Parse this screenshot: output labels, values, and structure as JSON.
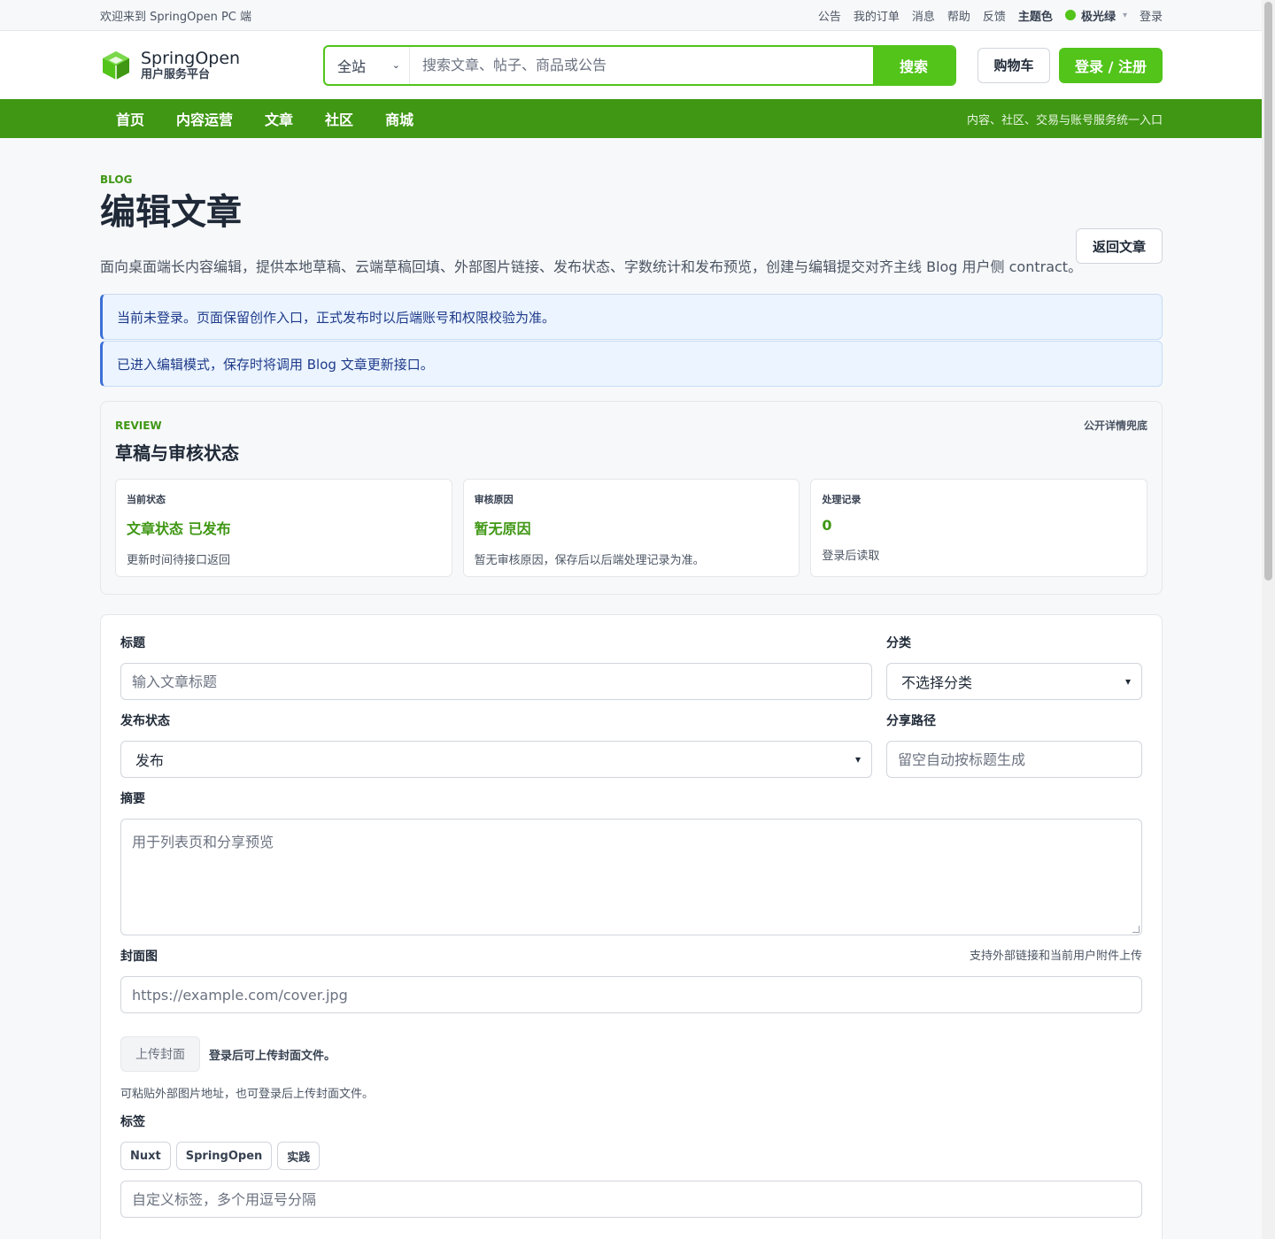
{
  "topbar": {
    "welcome": "欢迎来到 SpringOpen PC 端",
    "links": [
      "公告",
      "我的订单",
      "消息",
      "帮助",
      "反馈"
    ],
    "theme_label": "主题色",
    "theme_name": "极光绿",
    "theme_color": "#52c41a",
    "login": "登录"
  },
  "header": {
    "logo_title": "SpringOpen",
    "logo_subtitle": "用户服务平台",
    "search_scope": "全站",
    "search_placeholder": "搜索文章、帖子、商品或公告",
    "search_button": "搜索",
    "cart_button": "购物车",
    "login_button": "登录 / 注册"
  },
  "nav": {
    "items": [
      "首页",
      "内容运营",
      "文章",
      "社区",
      "商城"
    ],
    "tagline": "内容、社区、交易与账号服务统一入口",
    "color": "#3f9714"
  },
  "page": {
    "eyebrow": "BLOG",
    "title": "编辑文章",
    "back_button": "返回文章",
    "description": "面向桌面端长内容编辑，提供本地草稿、云端草稿回填、外部图片链接、发布状态、字数统计和发布预览，创建与编辑提交对齐主线 Blog 用户侧 contract。",
    "notices": [
      "当前未登录。页面保留创作入口，正式发布时以后端账号和权限校验为准。",
      "已进入编辑模式，保存时将调用 Blog 文章更新接口。"
    ]
  },
  "review": {
    "eyebrow": "REVIEW",
    "title": "草稿与审核状态",
    "link": "公开详情兜底",
    "stats": [
      {
        "label": "当前状态",
        "value": "文章状态 已发布",
        "note": "更新时间待接口返回"
      },
      {
        "label": "审核原因",
        "value": "暂无原因",
        "note": "暂无审核原因，保存后以后端处理记录为准。"
      },
      {
        "label": "处理记录",
        "value": "0",
        "note": "登录后读取"
      }
    ]
  },
  "form": {
    "title_label": "标题",
    "title_placeholder": "输入文章标题",
    "category_label": "分类",
    "category_value": "不选择分类",
    "status_label": "发布状态",
    "status_value": "发布",
    "share_label": "分享路径",
    "share_placeholder": "留空自动按标题生成",
    "summary_label": "摘要",
    "summary_placeholder": "用于列表页和分享预览",
    "cover_label": "封面图",
    "cover_hint": "支持外部链接和当前用户附件上传",
    "cover_placeholder": "https://example.com/cover.jpg",
    "upload_button": "上传封面",
    "upload_note": "登录后可上传封面文件。",
    "cover_help": "可粘贴外部图片地址，也可登录后上传封面文件。",
    "tags_label": "标签",
    "tags": [
      "Nuxt",
      "SpringOpen",
      "实践"
    ],
    "tag_placeholder": "自定义标签，多个用逗号分隔"
  }
}
